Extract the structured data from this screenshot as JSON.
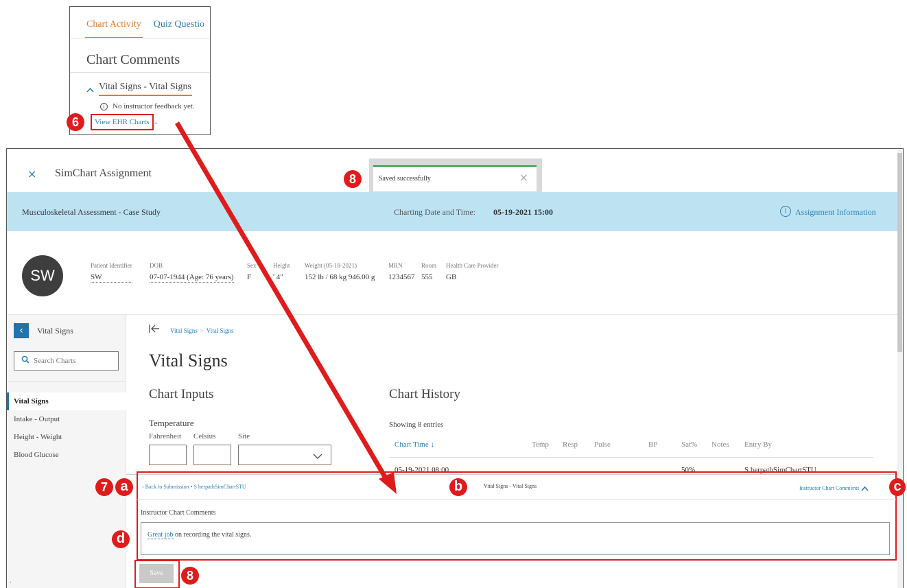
{
  "inset": {
    "tab_active": "Chart Activity",
    "tab_other": "Quiz Questio",
    "title": "Chart Comments",
    "section_label": "Vital Signs - Vital Signs",
    "feedback": "No instructor feedback yet.",
    "info_glyph": "i",
    "view_ehr": "View EHR Charts →"
  },
  "app": {
    "close_glyph": "×",
    "title": "SimChart Assignment"
  },
  "toast": {
    "message": "Saved successfully",
    "close_glyph": "×"
  },
  "banner": {
    "case_title": "Musculoskeletal Assessment - Case Study",
    "charting_label": "Charting Date and Time:",
    "charting_value": "05-19-2021 15:00",
    "assignment_info": "Assignment Information",
    "info_glyph": "i"
  },
  "patient": {
    "initials": "SW",
    "fields": [
      {
        "label": "Patient Identifier",
        "value": "SW"
      },
      {
        "label": "DOB",
        "value": "07-07-1944 (Age: 76 years)"
      },
      {
        "label": "Sex",
        "value": "F"
      },
      {
        "label": "Height",
        "value": "' 4\""
      },
      {
        "label": "Weight (05-18-2021)",
        "value": "152 lb / 68 kg 946.00 g"
      },
      {
        "label": "MRN",
        "value": "1234567"
      },
      {
        "label": "Room",
        "value": "555"
      },
      {
        "label": "Health Care Provider",
        "value": "GB"
      }
    ]
  },
  "sidebar": {
    "back_glyph": "‹",
    "title": "Vital Signs",
    "search_placeholder": "Search Charts",
    "items": [
      "Vital Signs",
      "Intake - Output",
      "Height - Weight",
      "Blood Glucose"
    ]
  },
  "content": {
    "breadcrumb": [
      "Vital Signs",
      "Vital Signs"
    ],
    "breadcrumb_sep": ">",
    "page_title": "Vital Signs",
    "chart_inputs": "Chart Inputs",
    "temperature_label": "Temperature",
    "field_labels": [
      "Fahrenheit",
      "Celsius",
      "Site"
    ],
    "chart_history": "Chart History",
    "showing": "Showing 8 entries",
    "columns": [
      "Chart Time ↓",
      "Temp",
      "Resp",
      "Pulse",
      "BP",
      "Sat%",
      "Notes",
      "Entry By"
    ],
    "row": {
      "time": "05-19-2021 08:00",
      "sat": "50%",
      "entry_by": "S herpathSimChartSTU"
    }
  },
  "comments_panel": {
    "back_link": "‹  Back to Submission • S herpathSimChartSTU",
    "center_label": "Vital Signs - Vital Signs",
    "toggle_label": "Instructor Chart Comments",
    "toggle_glyph": "⌃",
    "field_label": "Instructor Chart Comments",
    "comment_link": "Great job",
    "comment_rest": " on recording the vital signs.",
    "save_label": "Save"
  },
  "callouts": {
    "six": "6",
    "seven": "7",
    "eight_top": "8",
    "eight_bottom": "8",
    "a": "a",
    "b": "b",
    "c": "c",
    "d": "d"
  },
  "colors": {
    "accent_orange": "#e57a2a",
    "link_blue": "#2a7fb8",
    "banner_blue": "#bde3f3",
    "callout_red": "#e01b1b",
    "success_green": "#2e9a3e"
  }
}
